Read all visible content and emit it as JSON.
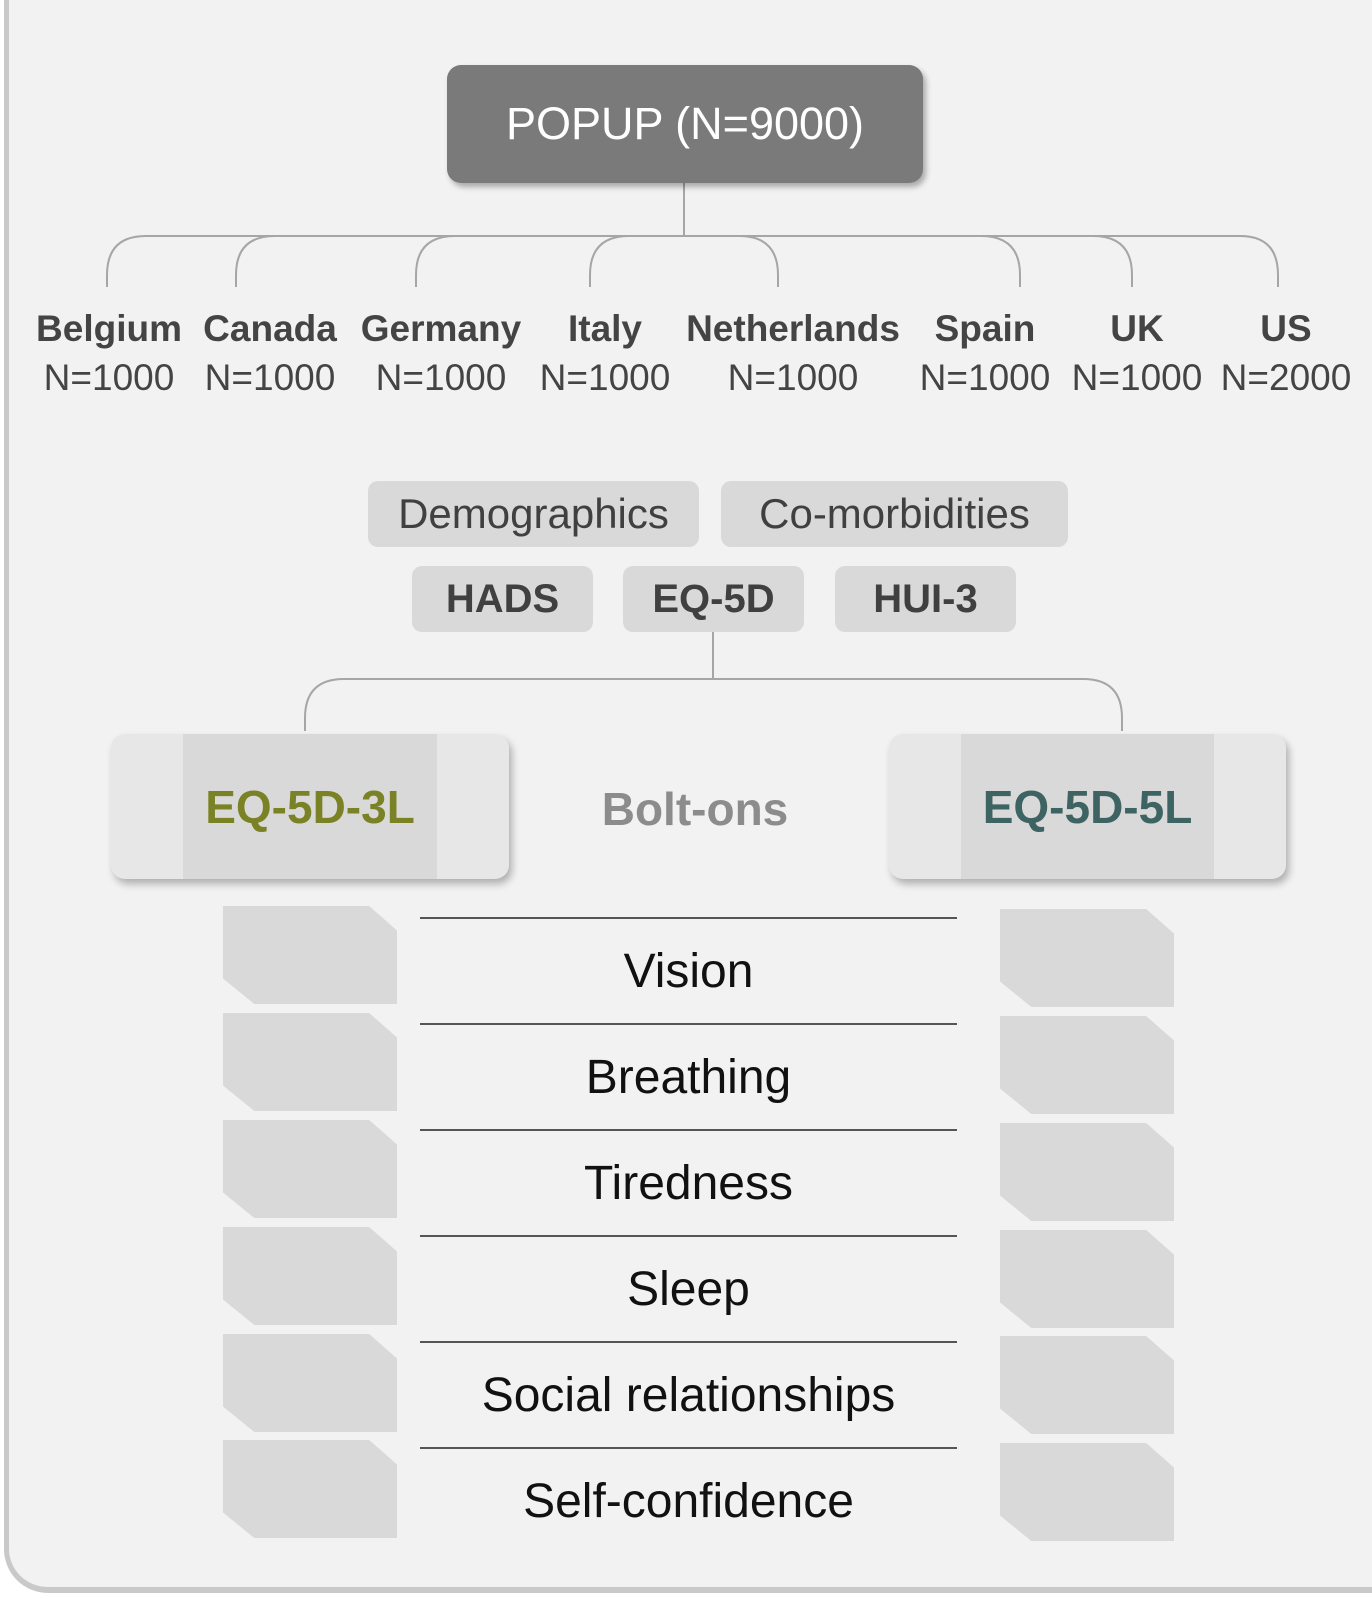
{
  "root": {
    "label": "POPUP (N=9000)"
  },
  "countries": [
    {
      "name": "Belgium",
      "n": "N=1000"
    },
    {
      "name": "Canada",
      "n": "N=1000"
    },
    {
      "name": "Germany",
      "n": "N=1000"
    },
    {
      "name": "Italy",
      "n": "N=1000"
    },
    {
      "name": "Netherlands",
      "n": "N=1000"
    },
    {
      "name": "Spain",
      "n": "N=1000"
    },
    {
      "name": "UK",
      "n": "N=1000"
    },
    {
      "name": "US",
      "n": "N=2000"
    }
  ],
  "measures": {
    "demographics": "Demographics",
    "comorbidities": "Co-morbidities",
    "hads": "HADS",
    "eq5d": "EQ-5D",
    "hui3": "HUI-3"
  },
  "versions": {
    "eq5d3l": {
      "label": "EQ-5D-3L",
      "color": "#7b8226"
    },
    "eq5d5l": {
      "label": "EQ-5D-5L",
      "color": "#3e6363"
    },
    "bolt_ons": "Bolt-ons"
  },
  "dimensions": [
    "Vision",
    "Breathing",
    "Tiredness",
    "Sleep",
    "Social relationships",
    "Self-confidence"
  ]
}
